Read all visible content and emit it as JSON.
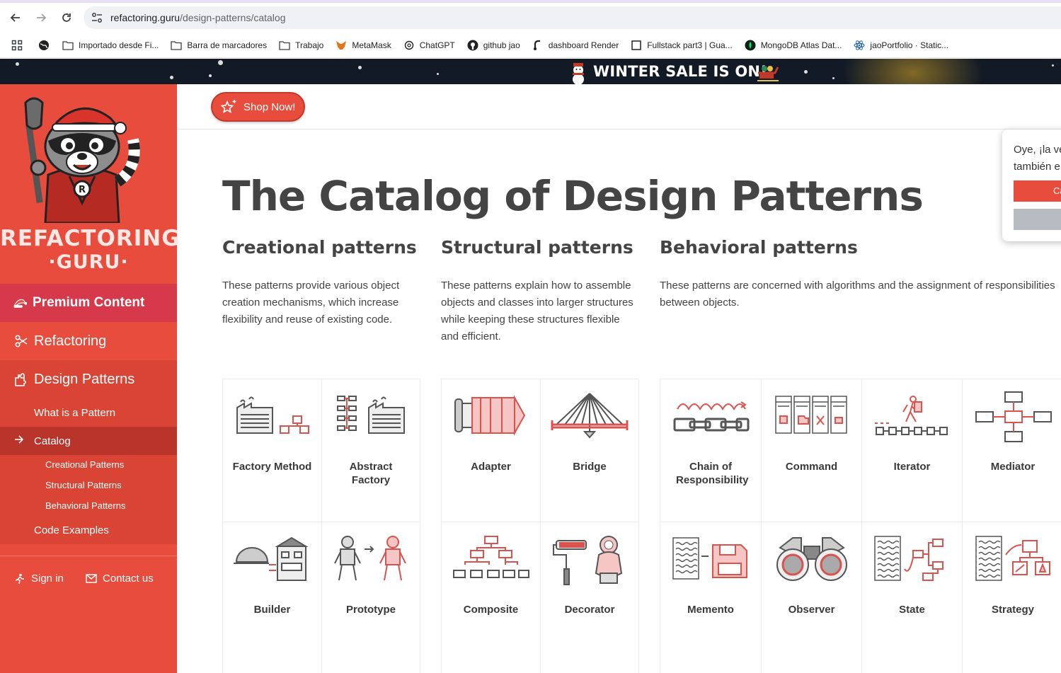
{
  "browser": {
    "url_host": "refactoring.guru",
    "url_path": "/design-patterns/catalog",
    "bookmarks": [
      {
        "label": "Importado desde Fi...",
        "icon": "folder-icon"
      },
      {
        "label": "Barra de marcadores",
        "icon": "folder-icon"
      },
      {
        "label": "Trabajo",
        "icon": "folder-icon"
      },
      {
        "label": "MetaMask",
        "icon": "metamask-icon"
      },
      {
        "label": "ChatGPT",
        "icon": "chatgpt-icon"
      },
      {
        "label": "github jao",
        "icon": "github-icon"
      },
      {
        "label": "dashboard Render",
        "icon": "render-icon"
      },
      {
        "label": "Fullstack part3 | Gua...",
        "icon": "fullstack-icon"
      },
      {
        "label": "MongoDB Atlas Dat...",
        "icon": "mongodb-icon"
      },
      {
        "label": "jaoPortfolio · Static...",
        "icon": "react-icon"
      }
    ]
  },
  "banner": {
    "text": "WINTER SALE IS ON!"
  },
  "sidebar": {
    "logo_line1": "REFACTORING",
    "logo_line2": "·GURU·",
    "premium": "Premium Content",
    "refactoring": "Refactoring",
    "design_patterns": "Design Patterns",
    "what_is": "What is a Pattern",
    "catalog": "Catalog",
    "creational": "Creational Patterns",
    "structural": "Structural Patterns",
    "behavioral": "Behavioral Patterns",
    "code_examples": "Code Examples",
    "sign_in": "Sign in",
    "contact": "Contact us"
  },
  "topbar": {
    "shop_label": "Shop Now!"
  },
  "main": {
    "title": "The Catalog of Design Patterns",
    "creational": {
      "heading": "Creational patterns",
      "desc": [
        "These patterns provide various object",
        "creation mechanisms, which increase",
        "flexibility and reuse of existing code."
      ],
      "cards": [
        "Factory Method",
        "Abstract Factory",
        "Builder",
        "Prototype"
      ]
    },
    "structural": {
      "heading": "Structural patterns",
      "desc": [
        "These patterns explain how to assemble",
        "objects and classes into larger structures",
        "while keeping these structures flexible",
        "and efficient."
      ],
      "cards": [
        "Adapter",
        "Bridge",
        "Composite",
        "Decorator"
      ]
    },
    "behavioral": {
      "heading": "Behavioral patterns",
      "desc": [
        "These patterns are concerned with algorithms and the assignment of responsibilities",
        "between objects."
      ],
      "cards": [
        "Chain of Responsibility",
        "Command",
        "Iterator",
        "Mediator",
        "Memento",
        "Observer",
        "State",
        "Strategy"
      ]
    }
  },
  "popup": {
    "line1": "Oye, ¡la ve",
    "line2": "también e",
    "btn": "Ca"
  },
  "colors": {
    "brand_red": "#e74c3c",
    "dark_red": "#b9342a",
    "text_dark": "#444444",
    "banner_bg": "#121a26"
  }
}
